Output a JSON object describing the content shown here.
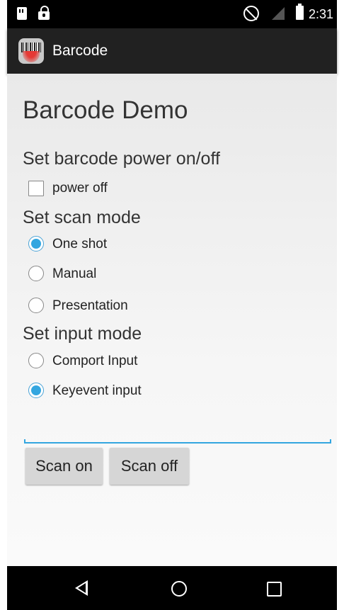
{
  "status_bar": {
    "time": "2:31"
  },
  "action_bar": {
    "title": "Barcode"
  },
  "main": {
    "heading": "Barcode Demo",
    "power": {
      "title": "Set barcode power on/off",
      "checkbox_label": "power off",
      "checked": false
    },
    "scan_mode": {
      "title": "Set scan mode",
      "options": [
        {
          "label": "One shot",
          "checked": true
        },
        {
          "label": "Manual",
          "checked": false
        },
        {
          "label": "Presentation",
          "checked": false
        }
      ]
    },
    "input_mode": {
      "title": "Set input mode",
      "options": [
        {
          "label": "Comport Input",
          "checked": false
        },
        {
          "label": "Keyevent input",
          "checked": true
        }
      ]
    },
    "input_field": {
      "value": "",
      "placeholder": ""
    },
    "buttons": {
      "scan_on": "Scan on",
      "scan_off": "Scan off"
    }
  },
  "colors": {
    "accent": "#33a6e0",
    "action_bar": "#212121"
  }
}
